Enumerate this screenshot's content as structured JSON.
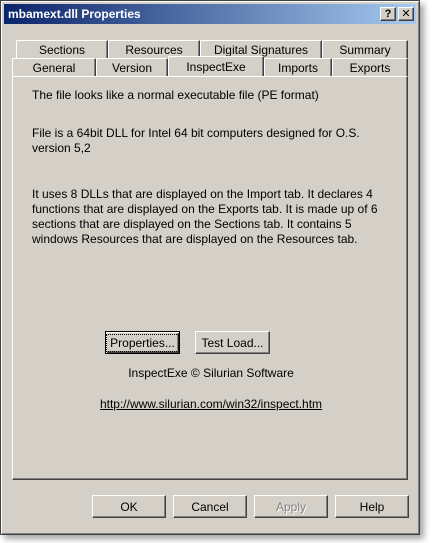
{
  "window": {
    "title": "mbamext.dll Properties",
    "help_glyph": "?",
    "close_glyph": "✕"
  },
  "tabs_row_back": [
    "Sections",
    "Resources",
    "Digital Signatures",
    "Summary"
  ],
  "tabs_row_front": [
    "General",
    "Version",
    "InspectExe",
    "Imports",
    "Exports"
  ],
  "active_tab": "InspectExe",
  "panel": {
    "para1": "The file looks like a normal executable file (PE format)",
    "para2": "File is a 64bit DLL for Intel 64 bit computers designed for O.S. version 5,2",
    "para3": "It uses 8 DLLs that are displayed on the Import tab. It declares 4 functions that are displayed on the Exports tab. It is made up of  6 sections that are displayed on the Sections tab. It contains 5 windows Resources that are displayed on the Resources tab.",
    "properties_button": "Properties...",
    "testload_button": "Test Load...",
    "credit": "InspectExe © Silurian Software",
    "url": "http://www.silurian.com/win32/inspect.htm"
  },
  "footer": {
    "ok": "OK",
    "cancel": "Cancel",
    "apply": "Apply",
    "help": "Help"
  }
}
